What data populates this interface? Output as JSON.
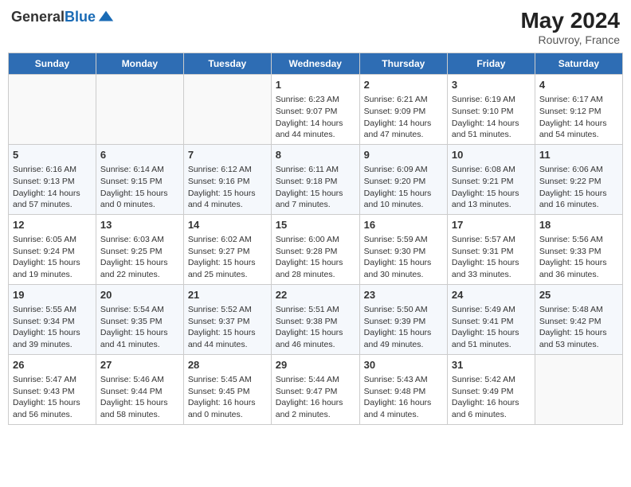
{
  "header": {
    "logo_general": "General",
    "logo_blue": "Blue",
    "month_year": "May 2024",
    "location": "Rouvroy, France"
  },
  "days_of_week": [
    "Sunday",
    "Monday",
    "Tuesday",
    "Wednesday",
    "Thursday",
    "Friday",
    "Saturday"
  ],
  "weeks": [
    [
      {
        "day": "",
        "content": ""
      },
      {
        "day": "",
        "content": ""
      },
      {
        "day": "",
        "content": ""
      },
      {
        "day": "1",
        "content": "Sunrise: 6:23 AM\nSunset: 9:07 PM\nDaylight: 14 hours\nand 44 minutes."
      },
      {
        "day": "2",
        "content": "Sunrise: 6:21 AM\nSunset: 9:09 PM\nDaylight: 14 hours\nand 47 minutes."
      },
      {
        "day": "3",
        "content": "Sunrise: 6:19 AM\nSunset: 9:10 PM\nDaylight: 14 hours\nand 51 minutes."
      },
      {
        "day": "4",
        "content": "Sunrise: 6:17 AM\nSunset: 9:12 PM\nDaylight: 14 hours\nand 54 minutes."
      }
    ],
    [
      {
        "day": "5",
        "content": "Sunrise: 6:16 AM\nSunset: 9:13 PM\nDaylight: 14 hours\nand 57 minutes."
      },
      {
        "day": "6",
        "content": "Sunrise: 6:14 AM\nSunset: 9:15 PM\nDaylight: 15 hours\nand 0 minutes."
      },
      {
        "day": "7",
        "content": "Sunrise: 6:12 AM\nSunset: 9:16 PM\nDaylight: 15 hours\nand 4 minutes."
      },
      {
        "day": "8",
        "content": "Sunrise: 6:11 AM\nSunset: 9:18 PM\nDaylight: 15 hours\nand 7 minutes."
      },
      {
        "day": "9",
        "content": "Sunrise: 6:09 AM\nSunset: 9:20 PM\nDaylight: 15 hours\nand 10 minutes."
      },
      {
        "day": "10",
        "content": "Sunrise: 6:08 AM\nSunset: 9:21 PM\nDaylight: 15 hours\nand 13 minutes."
      },
      {
        "day": "11",
        "content": "Sunrise: 6:06 AM\nSunset: 9:22 PM\nDaylight: 15 hours\nand 16 minutes."
      }
    ],
    [
      {
        "day": "12",
        "content": "Sunrise: 6:05 AM\nSunset: 9:24 PM\nDaylight: 15 hours\nand 19 minutes."
      },
      {
        "day": "13",
        "content": "Sunrise: 6:03 AM\nSunset: 9:25 PM\nDaylight: 15 hours\nand 22 minutes."
      },
      {
        "day": "14",
        "content": "Sunrise: 6:02 AM\nSunset: 9:27 PM\nDaylight: 15 hours\nand 25 minutes."
      },
      {
        "day": "15",
        "content": "Sunrise: 6:00 AM\nSunset: 9:28 PM\nDaylight: 15 hours\nand 28 minutes."
      },
      {
        "day": "16",
        "content": "Sunrise: 5:59 AM\nSunset: 9:30 PM\nDaylight: 15 hours\nand 30 minutes."
      },
      {
        "day": "17",
        "content": "Sunrise: 5:57 AM\nSunset: 9:31 PM\nDaylight: 15 hours\nand 33 minutes."
      },
      {
        "day": "18",
        "content": "Sunrise: 5:56 AM\nSunset: 9:33 PM\nDaylight: 15 hours\nand 36 minutes."
      }
    ],
    [
      {
        "day": "19",
        "content": "Sunrise: 5:55 AM\nSunset: 9:34 PM\nDaylight: 15 hours\nand 39 minutes."
      },
      {
        "day": "20",
        "content": "Sunrise: 5:54 AM\nSunset: 9:35 PM\nDaylight: 15 hours\nand 41 minutes."
      },
      {
        "day": "21",
        "content": "Sunrise: 5:52 AM\nSunset: 9:37 PM\nDaylight: 15 hours\nand 44 minutes."
      },
      {
        "day": "22",
        "content": "Sunrise: 5:51 AM\nSunset: 9:38 PM\nDaylight: 15 hours\nand 46 minutes."
      },
      {
        "day": "23",
        "content": "Sunrise: 5:50 AM\nSunset: 9:39 PM\nDaylight: 15 hours\nand 49 minutes."
      },
      {
        "day": "24",
        "content": "Sunrise: 5:49 AM\nSunset: 9:41 PM\nDaylight: 15 hours\nand 51 minutes."
      },
      {
        "day": "25",
        "content": "Sunrise: 5:48 AM\nSunset: 9:42 PM\nDaylight: 15 hours\nand 53 minutes."
      }
    ],
    [
      {
        "day": "26",
        "content": "Sunrise: 5:47 AM\nSunset: 9:43 PM\nDaylight: 15 hours\nand 56 minutes."
      },
      {
        "day": "27",
        "content": "Sunrise: 5:46 AM\nSunset: 9:44 PM\nDaylight: 15 hours\nand 58 minutes."
      },
      {
        "day": "28",
        "content": "Sunrise: 5:45 AM\nSunset: 9:45 PM\nDaylight: 16 hours\nand 0 minutes."
      },
      {
        "day": "29",
        "content": "Sunrise: 5:44 AM\nSunset: 9:47 PM\nDaylight: 16 hours\nand 2 minutes."
      },
      {
        "day": "30",
        "content": "Sunrise: 5:43 AM\nSunset: 9:48 PM\nDaylight: 16 hours\nand 4 minutes."
      },
      {
        "day": "31",
        "content": "Sunrise: 5:42 AM\nSunset: 9:49 PM\nDaylight: 16 hours\nand 6 minutes."
      },
      {
        "day": "",
        "content": ""
      }
    ]
  ]
}
